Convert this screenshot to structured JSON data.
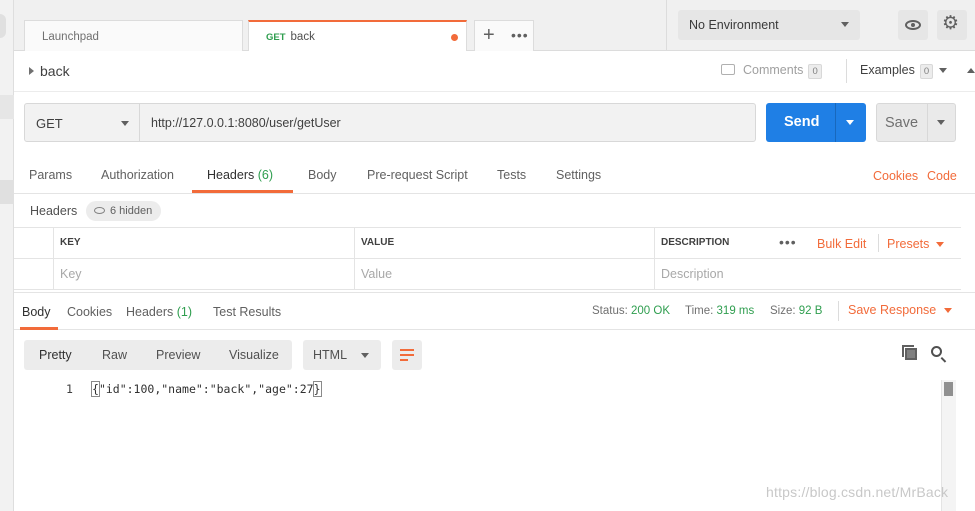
{
  "tabs": [
    {
      "label": "Launchpad",
      "method": ""
    },
    {
      "label": "back",
      "method": "GET",
      "unsaved": true
    }
  ],
  "tab_actions": {
    "add_symbol": "+",
    "more_symbol": "•••"
  },
  "environment": {
    "selected": "No Environment"
  },
  "request": {
    "name": "back",
    "comments_label": "Comments",
    "comments_count": "0",
    "examples_label": "Examples",
    "examples_count": "0",
    "method": "GET",
    "url": "http://127.0.0.1:8080/user/getUser",
    "send_label": "Send",
    "save_label": "Save"
  },
  "request_tabs": [
    {
      "label": "Params"
    },
    {
      "label": "Authorization"
    },
    {
      "label": "Headers",
      "count": "(6)"
    },
    {
      "label": "Body"
    },
    {
      "label": "Pre-request Script"
    },
    {
      "label": "Tests"
    },
    {
      "label": "Settings"
    }
  ],
  "request_links": {
    "cookies": "Cookies",
    "code": "Code"
  },
  "headers_section": {
    "title": "Headers",
    "hidden_label": "6 hidden",
    "columns": [
      "KEY",
      "VALUE",
      "DESCRIPTION"
    ],
    "placeholders": {
      "key": "Key",
      "value": "Value",
      "description": "Description"
    },
    "more_symbol": "•••",
    "bulk_edit": "Bulk Edit",
    "presets": "Presets"
  },
  "response_tabs": [
    {
      "label": "Body"
    },
    {
      "label": "Cookies"
    },
    {
      "label": "Headers",
      "count": "(1)"
    },
    {
      "label": "Test Results"
    }
  ],
  "response_status": {
    "status_label": "Status:",
    "status_value": "200 OK",
    "time_label": "Time:",
    "time_value": "319 ms",
    "size_label": "Size:",
    "size_value": "92 B",
    "save_response": "Save Response"
  },
  "view_modes": [
    "Pretty",
    "Raw",
    "Preview",
    "Visualize"
  ],
  "format": "HTML",
  "response_body": {
    "line_number": "1",
    "open_brace": "{",
    "content": "\"id\":100,\"name\":\"back\",\"age\":27",
    "close_brace": "}"
  },
  "watermark": "https://blog.csdn.net/MrBack",
  "colors": {
    "accent": "#f26b3a",
    "send": "#1f7fe5",
    "success": "#2f9e4f"
  }
}
